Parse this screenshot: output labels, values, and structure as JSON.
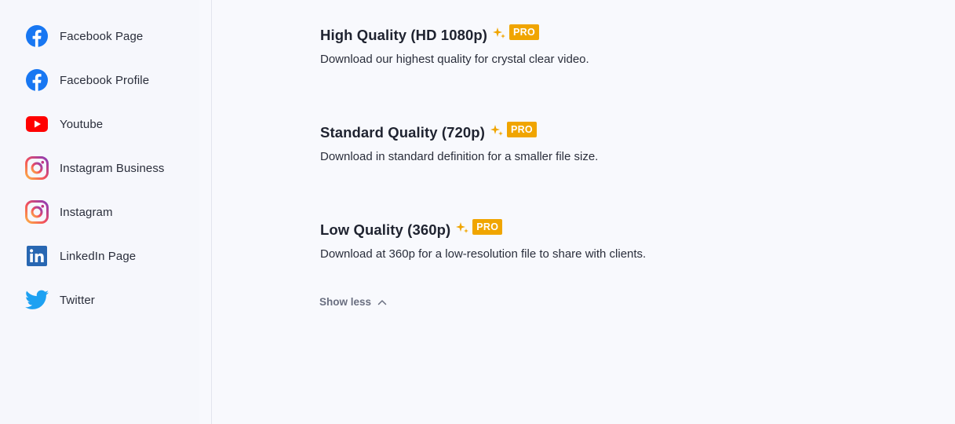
{
  "sidebar": {
    "items": [
      {
        "label": "Facebook Page",
        "icon": "facebook-icon"
      },
      {
        "label": "Facebook Profile",
        "icon": "facebook-icon"
      },
      {
        "label": "Youtube",
        "icon": "youtube-icon"
      },
      {
        "label": "Instagram Business",
        "icon": "instagram-icon"
      },
      {
        "label": "Instagram",
        "icon": "instagram-icon"
      },
      {
        "label": "LinkedIn Page",
        "icon": "linkedin-icon"
      },
      {
        "label": "Twitter",
        "icon": "twitter-icon"
      }
    ]
  },
  "main": {
    "options": [
      {
        "title": "High Quality (HD 1080p)",
        "badge": "PRO",
        "description": "Download our highest quality for crystal clear video."
      },
      {
        "title": "Standard Quality (720p)",
        "badge": "PRO",
        "description": "Download in standard definition for a smaller file size."
      },
      {
        "title": "Low Quality (360p)",
        "badge": "PRO",
        "description": "Download at 360p for a low-resolution file to share with clients."
      }
    ],
    "show_less_label": "Show less"
  },
  "colors": {
    "facebook": "#1877f2",
    "youtube": "#ff0000",
    "linkedin": "#2867b2",
    "twitter": "#1da1f2",
    "pro_badge": "#f0a500",
    "sparkle": "#f0a500"
  }
}
